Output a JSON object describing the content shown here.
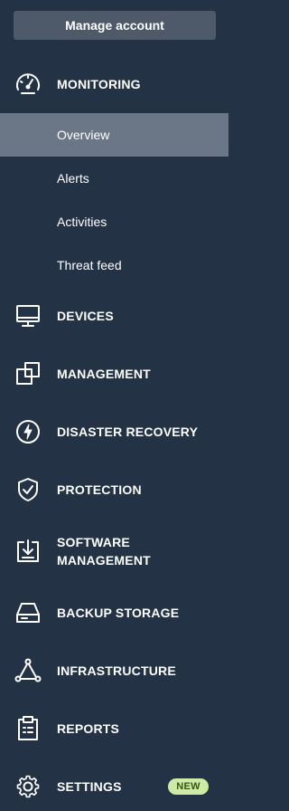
{
  "manage_account_label": "Manage account",
  "nav": {
    "monitoring": {
      "label": "MONITORING",
      "icon": "speedometer-icon",
      "subitems": [
        {
          "label": "Overview",
          "active": true
        },
        {
          "label": "Alerts",
          "active": false
        },
        {
          "label": "Activities",
          "active": false
        },
        {
          "label": "Threat feed",
          "active": false
        }
      ]
    },
    "devices": {
      "label": "DEVICES",
      "icon": "monitor-icon"
    },
    "management": {
      "label": "MANAGEMENT",
      "icon": "overlapping-squares-icon"
    },
    "disaster_recovery": {
      "label": "DISASTER RECOVERY",
      "icon": "lightning-circle-icon"
    },
    "protection": {
      "label": "PROTECTION",
      "icon": "shield-check-icon"
    },
    "software_management": {
      "label_line1": "SOFTWARE",
      "label_line2": "MANAGEMENT",
      "icon": "download-box-icon"
    },
    "backup_storage": {
      "label": "BACKUP STORAGE",
      "icon": "hard-drive-icon"
    },
    "infrastructure": {
      "label": "INFRASTRUCTURE",
      "icon": "network-triangle-icon"
    },
    "reports": {
      "label": "REPORTS",
      "icon": "clipboard-icon"
    },
    "settings": {
      "label": "SETTINGS",
      "icon": "gear-icon",
      "badge": "NEW"
    }
  },
  "colors": {
    "background": "#243245",
    "active_subitem": "#6b7787",
    "manage_button": "#4e5a69",
    "badge_bg": "#cfe9a6",
    "badge_text": "#2e5a14"
  }
}
